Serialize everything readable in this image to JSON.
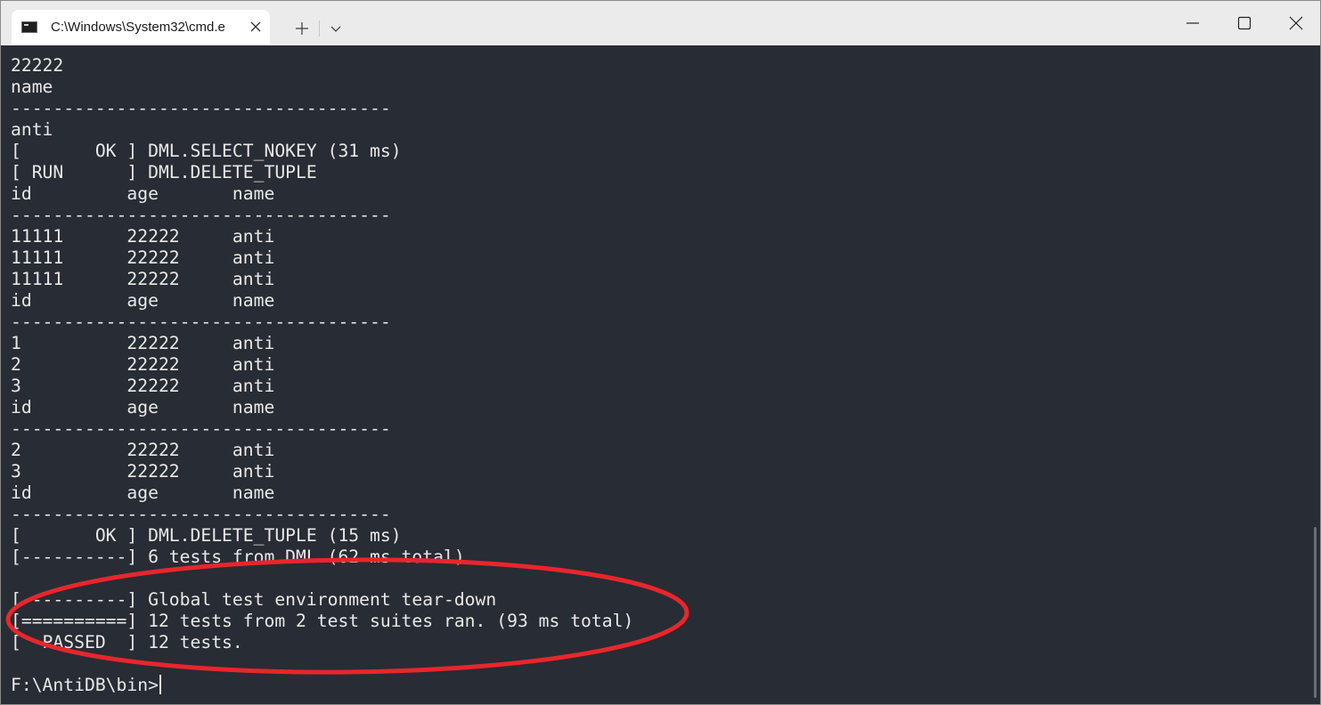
{
  "window": {
    "tab_title": "C:\\Windows\\System32\\cmd.e",
    "tab_icon": "terminal-icon",
    "new_tab_label": "+",
    "close_tab_label": "✕"
  },
  "terminal": {
    "lines": [
      "22222",
      "name",
      "------------------------------------",
      "anti",
      "[       OK ] DML.SELECT_NOKEY (31 ms)",
      "[ RUN      ] DML.DELETE_TUPLE",
      "id         age       name",
      "------------------------------------",
      "11111      22222     anti",
      "11111      22222     anti",
      "11111      22222     anti",
      "id         age       name",
      "------------------------------------",
      "1          22222     anti",
      "2          22222     anti",
      "3          22222     anti",
      "id         age       name",
      "------------------------------------",
      "2          22222     anti",
      "3          22222     anti",
      "id         age       name",
      "------------------------------------",
      "[       OK ] DML.DELETE_TUPLE (15 ms)",
      "[----------] 6 tests from DML (62 ms total)",
      "",
      "[----------] Global test environment tear-down",
      "[==========] 12 tests from 2 test suites ran. (93 ms total)",
      "[  PASSED  ] 12 tests.",
      "",
      "F:\\AntiDB\\bin>"
    ]
  },
  "colors": {
    "terminal_bg": "#282c34",
    "terminal_fg": "#e8e8e8",
    "annotation": "#e8262c"
  }
}
